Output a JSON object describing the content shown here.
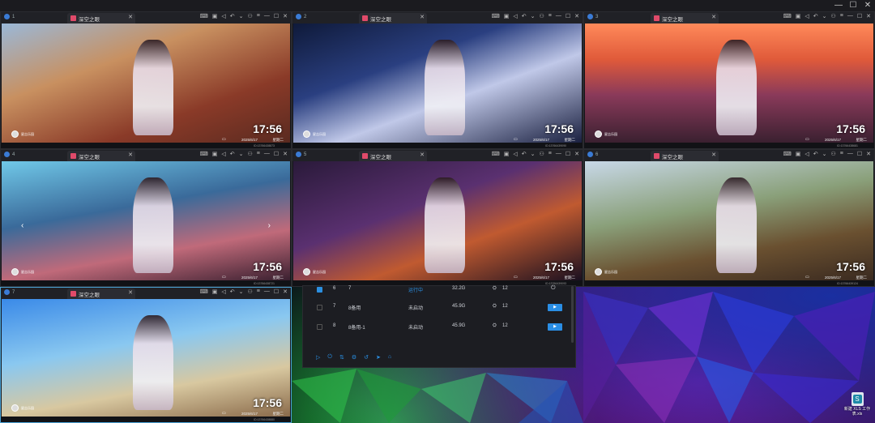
{
  "window": {
    "minimize": "—",
    "maximize": "☐",
    "close": "✕"
  },
  "panes": [
    {
      "num": "1",
      "tab": "深空之眼",
      "time": "17:56",
      "date": "2025/6/17",
      "weekday": "星期二",
      "user": "星吉乐园",
      "device_id": "ID:13766438873",
      "active": true
    },
    {
      "num": "2",
      "tab": "深空之眼",
      "time": "17:56",
      "date": "2025/6/17",
      "weekday": "星期二",
      "user": "星吉乐园",
      "device_id": "ID:13766439090",
      "active": false
    },
    {
      "num": "3",
      "tab": "深空之眼",
      "time": "17:56",
      "date": "2025/6/17",
      "weekday": "星期二",
      "user": "星吉乐园",
      "device_id": "ID:13766438681",
      "active": false
    },
    {
      "num": "4",
      "tab": "深空之眼",
      "time": "17:56",
      "date": "2025/6/17",
      "weekday": "星期二",
      "user": "星吉乐园",
      "device_id": "ID:13766438721",
      "active": false
    },
    {
      "num": "5",
      "tab": "深空之眼",
      "time": "17:56",
      "date": "2025/6/17",
      "weekday": "星期二",
      "user": "星吉乐园",
      "device_id": "ID:13766439093",
      "active": false
    },
    {
      "num": "6",
      "tab": "深空之眼",
      "time": "17:56",
      "date": "2025/6/17",
      "weekday": "星期二",
      "user": "星吉乐园",
      "device_id": "ID:13766439124",
      "active": false
    },
    {
      "num": "7",
      "tab": "深空之眼",
      "time": "17:56",
      "date": "2025/6/17",
      "weekday": "星期二",
      "user": "星吉乐园",
      "device_id": "ID:13766438880",
      "active": true
    }
  ],
  "manager": {
    "rows": [
      {
        "index": "6",
        "name": "7",
        "status": "运行中",
        "size": "32.2G",
        "count": "12",
        "checked": true
      },
      {
        "index": "7",
        "name": "8备用",
        "status": "未启动",
        "size": "45.9G",
        "count": "12",
        "checked": false
      },
      {
        "index": "8",
        "name": "8备用-1",
        "status": "未启动",
        "size": "45.9G",
        "count": "12",
        "checked": false
      }
    ],
    "play_label": "▶",
    "toolbar_icons": [
      "play-icon",
      "power-icon",
      "sort-icon",
      "settings-icon",
      "sync-icon",
      "send-icon",
      "delete-icon"
    ]
  },
  "desktop_icon": {
    "label": "新建 XLS 工作表.xls"
  },
  "colors": {
    "accent": "#2a91e6",
    "titlebar": "#202126"
  }
}
